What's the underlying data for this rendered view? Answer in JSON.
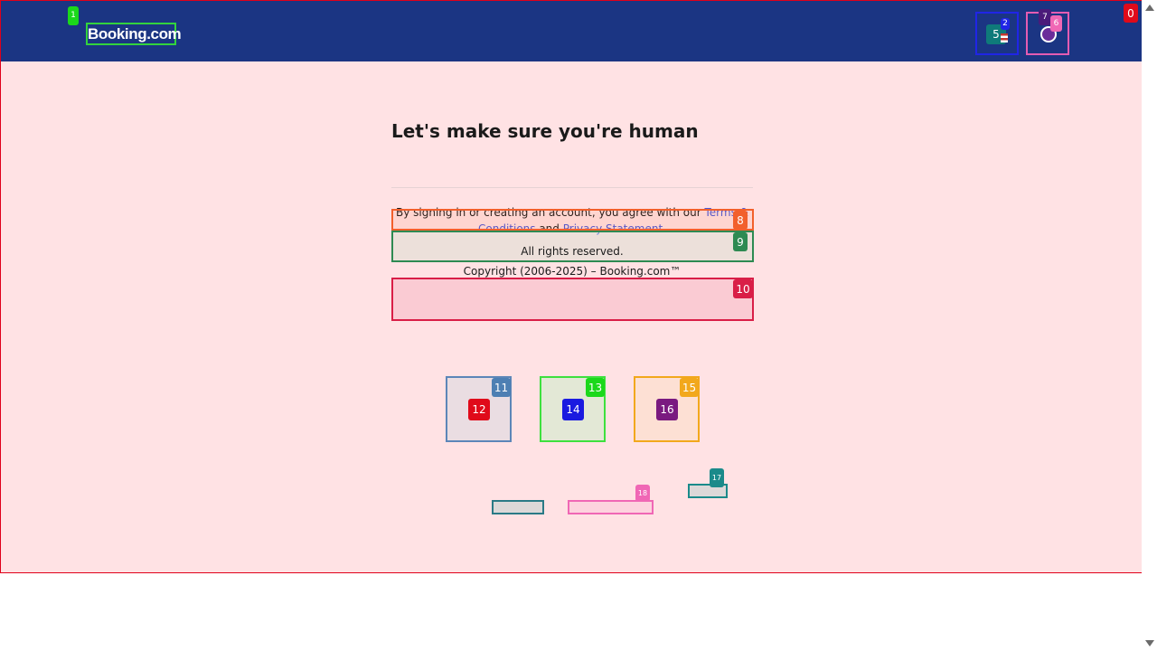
{
  "brand": {
    "logo_text": "Booking.com"
  },
  "main": {
    "heading": "Let's make sure you're human",
    "terms_prefix": "By signing in or creating an account, you agree with our ",
    "terms_link": "Terms & Conditions",
    "terms_and": " and ",
    "privacy_link": "Privacy Statement",
    "terms_suffix": ".",
    "rights": "All rights reserved.",
    "copyright": "Copyright (2006-2025) – Booking.com™"
  },
  "markers": {
    "m0": "0",
    "m1": "1",
    "m2": "2",
    "m5": "5",
    "m6": "6",
    "m7": "7",
    "m8": "8",
    "m9": "9",
    "m10": "10",
    "m11": "11",
    "m12": "12",
    "m13": "13",
    "m14": "14",
    "m15": "15",
    "m16": "16",
    "m17": "17",
    "m18": "18"
  },
  "colors": {
    "header_bg": "#1b3583",
    "page_bg": "#ffe2e4",
    "link": "#4b59d9"
  }
}
